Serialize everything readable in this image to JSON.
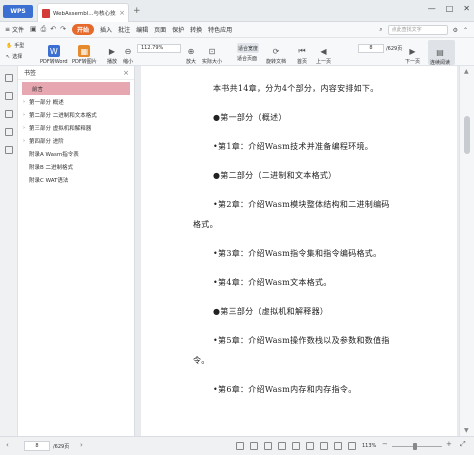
{
  "titlebar": {
    "app_tab": "WPS",
    "doc_tab": "WebAssembl...与核心技术_.pdf",
    "new_tab": "+",
    "controls": [
      "—",
      "□",
      "✕"
    ]
  },
  "menubar": {
    "file": "文件",
    "start": "开始",
    "items": [
      "插入",
      "批注",
      "编辑",
      "页面",
      "保护",
      "转换",
      "特色应用"
    ],
    "search_placeholder": "点此查找文字"
  },
  "toolbar": {
    "hand": "手型",
    "select": "选择",
    "pdf_to_word": "PDF转Word",
    "pdf_to_image": "PDF转图片",
    "play": "播放",
    "shrink": "缩小",
    "zoom": "112.79%",
    "enlarge": "放大",
    "actual_size": "实际大小",
    "fit_width": "适合宽度",
    "fit_page": "适合页面",
    "rotate_doc": "旋转文档",
    "first_page": "首页",
    "prev_page": "上一页",
    "page_current": "8",
    "page_total": "/629页",
    "next_page": "下一页",
    "continuous": "连续阅读"
  },
  "bookmark": {
    "title": "书签",
    "items": [
      {
        "label": "前言",
        "selected": true,
        "expandable": false
      },
      {
        "label": "第一部分 概述",
        "selected": false,
        "expandable": true
      },
      {
        "label": "第二部分 二进制和文本格式",
        "selected": false,
        "expandable": true
      },
      {
        "label": "第三部分 虚拟机和解释器",
        "selected": false,
        "expandable": true
      },
      {
        "label": "第四部分 进阶",
        "selected": false,
        "expandable": true
      },
      {
        "label": "附录A Wasm指令表",
        "selected": false,
        "expandable": false
      },
      {
        "label": "附录B 二进制格式",
        "selected": false,
        "expandable": false
      },
      {
        "label": "附录C WAT语法",
        "selected": false,
        "expandable": false
      }
    ]
  },
  "document": {
    "paragraphs": [
      {
        "text": "本书共14章，分为4个部分，内容安排如下。",
        "indent": true
      },
      {
        "text": "●第一部分（概述）",
        "indent": true
      },
      {
        "text": "•第1章：介绍Wasm技术并准备编程环境。",
        "indent": true
      },
      {
        "text": "●第二部分（二进制和文本格式）",
        "indent": true
      },
      {
        "text": "•第2章：介绍Wasm模块整体结构和二进制编码",
        "indent": true
      },
      {
        "text": "格式。",
        "indent": false
      },
      {
        "text": "•第3章：介绍Wasm指令集和指令编码格式。",
        "indent": true
      },
      {
        "text": "•第4章：介绍Wasm文本格式。",
        "indent": true
      },
      {
        "text": "●第三部分（虚拟机和解释器）",
        "indent": true
      },
      {
        "text": "•第5章：介绍Wasm操作数栈以及参数和数值指",
        "indent": true
      },
      {
        "text": "令。",
        "indent": false
      },
      {
        "text": "•第6章：介绍Wasm内存和内存指令。",
        "indent": true
      }
    ]
  },
  "statusbar": {
    "page_current": "8",
    "page_total": "/629页",
    "zoom": "113%"
  },
  "colors": {
    "accent": "#3b6fd1",
    "start_button": "#e66a2c",
    "selected_bookmark": "#e6a7b1",
    "pdf_badge": "#d33b36"
  }
}
